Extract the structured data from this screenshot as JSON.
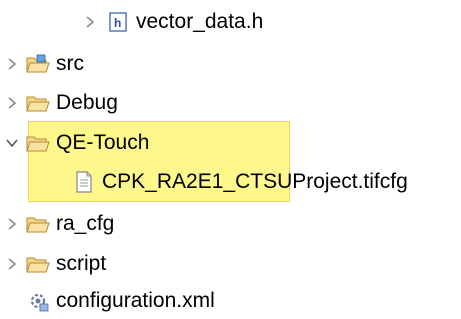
{
  "tree": {
    "items": [
      {
        "label": "vector_data.h",
        "icon": "header-file-icon",
        "expanded": false
      },
      {
        "label": "src",
        "icon": "source-folder-icon",
        "expanded": false
      },
      {
        "label": "Debug",
        "icon": "folder-icon",
        "expanded": false
      },
      {
        "label": "QE-Touch",
        "icon": "folder-icon",
        "expanded": true
      },
      {
        "label": "CPK_RA2E1_CTSUProject.tifcfg",
        "icon": "file-icon"
      },
      {
        "label": "ra_cfg",
        "icon": "folder-icon",
        "expanded": false
      },
      {
        "label": "script",
        "icon": "folder-icon",
        "expanded": false
      },
      {
        "label": "configuration.xml",
        "icon": "config-file-icon"
      }
    ]
  },
  "colors": {
    "highlight": "#fdf78c",
    "folder": "#e8c26a",
    "chevron": "#8a8a8a"
  }
}
